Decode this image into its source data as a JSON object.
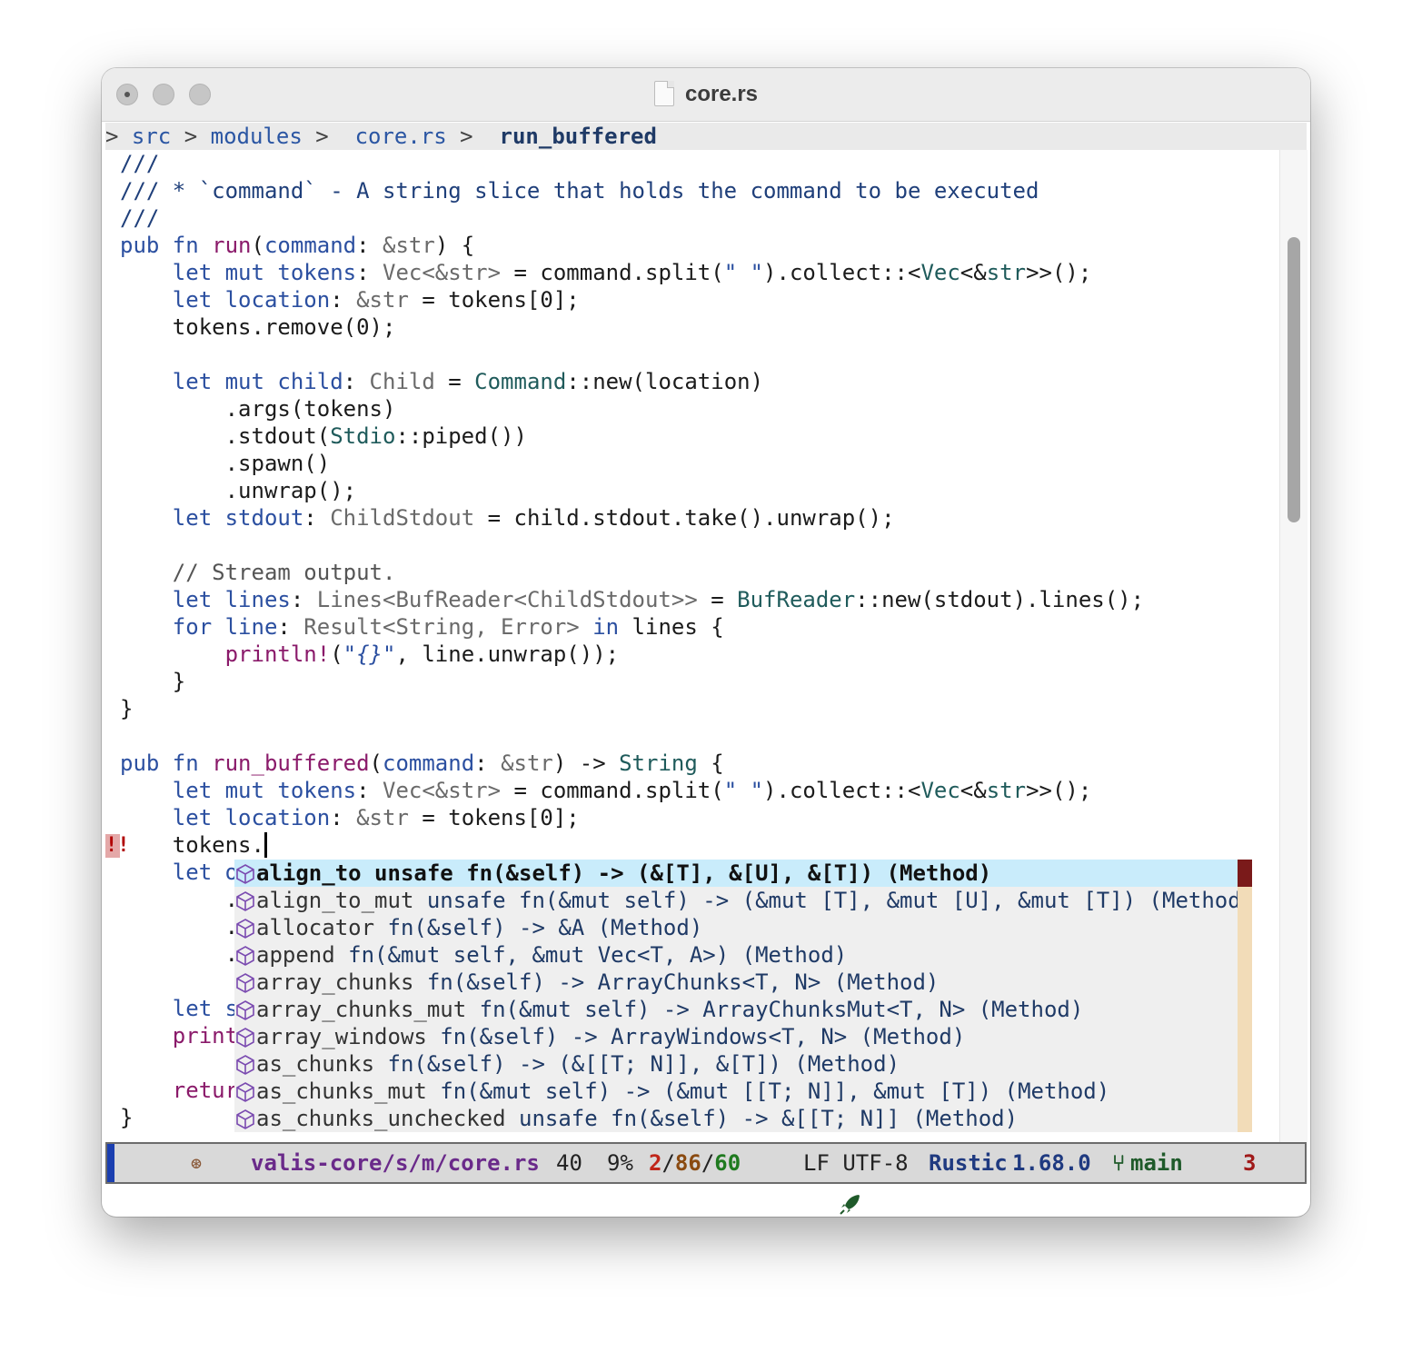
{
  "window": {
    "title": "core.rs"
  },
  "breadcrumb": {
    "prefix": "> ",
    "items": [
      "src",
      "modules",
      "core.rs"
    ],
    "separators": [
      " > ",
      " >  ",
      " >  "
    ],
    "symbol": "run_buffered"
  },
  "code": {
    "l1": "///",
    "l2": "/// * `command` - A string slice that holds the command to be executed",
    "l3": "///",
    "l23a": "tokens.",
    "l24_visible": "let o",
    "l25_visible": ".",
    "l26_visible": ".",
    "l27_visible": ".",
    "l29_visible": "let s",
    "l30_visible": "print",
    "l32_visible": "retur",
    "l33": "}"
  },
  "fringe": {
    "error_mark": "!!"
  },
  "completion": {
    "items": [
      {
        "name": "align_to",
        "sig": "unsafe fn(&self) -> (&[T], &[U], &[T]) (Method)"
      },
      {
        "name": "align_to_mut",
        "sig": "unsafe fn(&mut self) -> (&mut [T], &mut [U], &mut [T]) (Method)"
      },
      {
        "name": "allocator",
        "sig": "fn(&self) -> &A (Method)"
      },
      {
        "name": "append",
        "sig": "fn(&mut self, &mut Vec<T, A>) (Method)"
      },
      {
        "name": "array_chunks",
        "sig": "fn(&self) -> ArrayChunks<T, N> (Method)"
      },
      {
        "name": "array_chunks_mut",
        "sig": "fn(&mut self) -> ArrayChunksMut<T, N> (Method)"
      },
      {
        "name": "array_windows",
        "sig": "fn(&self) -> ArrayWindows<T, N> (Method)"
      },
      {
        "name": "as_chunks",
        "sig": "fn(&self) -> (&[[T; N]], &[T]) (Method)"
      },
      {
        "name": "as_chunks_mut",
        "sig": "fn(&mut self) -> (&mut [[T; N]], &mut [T]) (Method)"
      },
      {
        "name": "as_chunks_unchecked",
        "sig": "unsafe fn(&self) -> &[[T; N]] (Method)"
      }
    ],
    "item_icon": "method-cube-icon"
  },
  "modeline": {
    "icon": "⊛",
    "file": "valis-core/s/m/core.rs",
    "line": "40",
    "percent": "9%",
    "err_count": "2",
    "warn_count": "86",
    "info_count": "60",
    "sep": "/",
    "encoding": "LF UTF-8",
    "mode": "Rustic",
    "version": "1.68.0",
    "branch": "main",
    "errors": "3",
    "accent_color": "#1b3fb0"
  }
}
